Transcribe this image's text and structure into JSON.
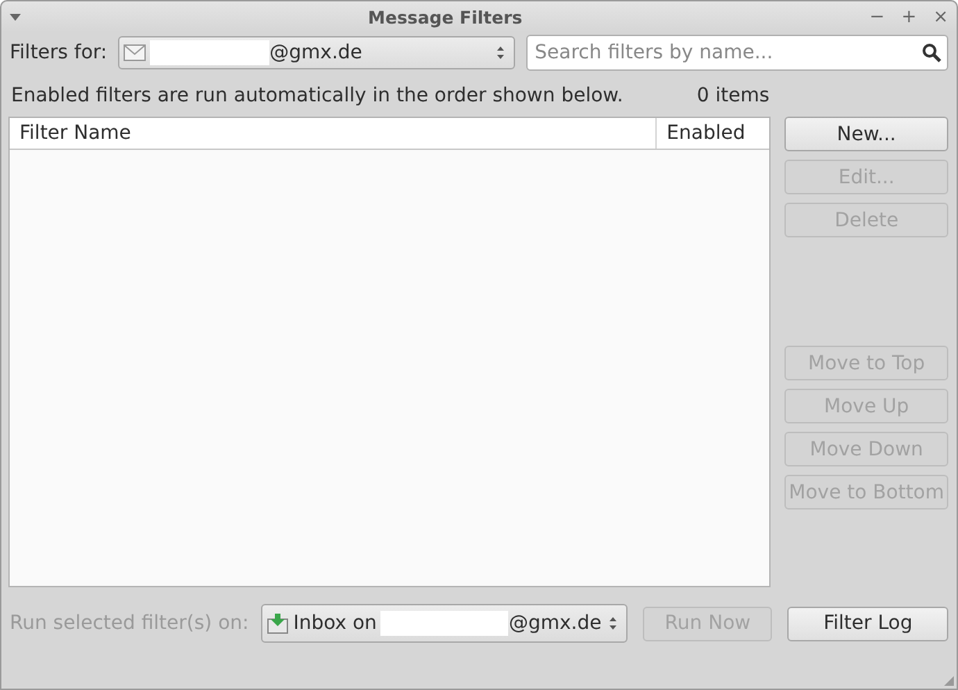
{
  "window": {
    "title": "Message Filters",
    "controls": [
      "−",
      "+",
      "×"
    ]
  },
  "filters_for": {
    "label": "Filters for:",
    "account": "@gmx.de"
  },
  "search": {
    "placeholder": "Search filters by name..."
  },
  "info": {
    "text": "Enabled filters are run automatically in the order shown below.",
    "count": "0 items"
  },
  "table": {
    "columns": [
      "Filter Name",
      "Enabled"
    ]
  },
  "edit_buttons": [
    {
      "label": "New...",
      "disabled": false
    },
    {
      "label": "Edit...",
      "disabled": true
    },
    {
      "label": "Delete",
      "disabled": true
    }
  ],
  "move_buttons": [
    {
      "label": "Move to Top",
      "disabled": true
    },
    {
      "label": "Move Up",
      "disabled": true
    },
    {
      "label": "Move Down",
      "disabled": true
    },
    {
      "label": "Move to Bottom",
      "disabled": true
    }
  ],
  "run_bar": {
    "label": "Run selected filter(s) on:",
    "label_disabled": true,
    "folder_prefix": "Inbox on",
    "folder_account": "@gmx.de",
    "run_button": {
      "label": "Run Now",
      "disabled": true
    },
    "log_button": {
      "label": "Filter Log",
      "disabled": false
    }
  }
}
